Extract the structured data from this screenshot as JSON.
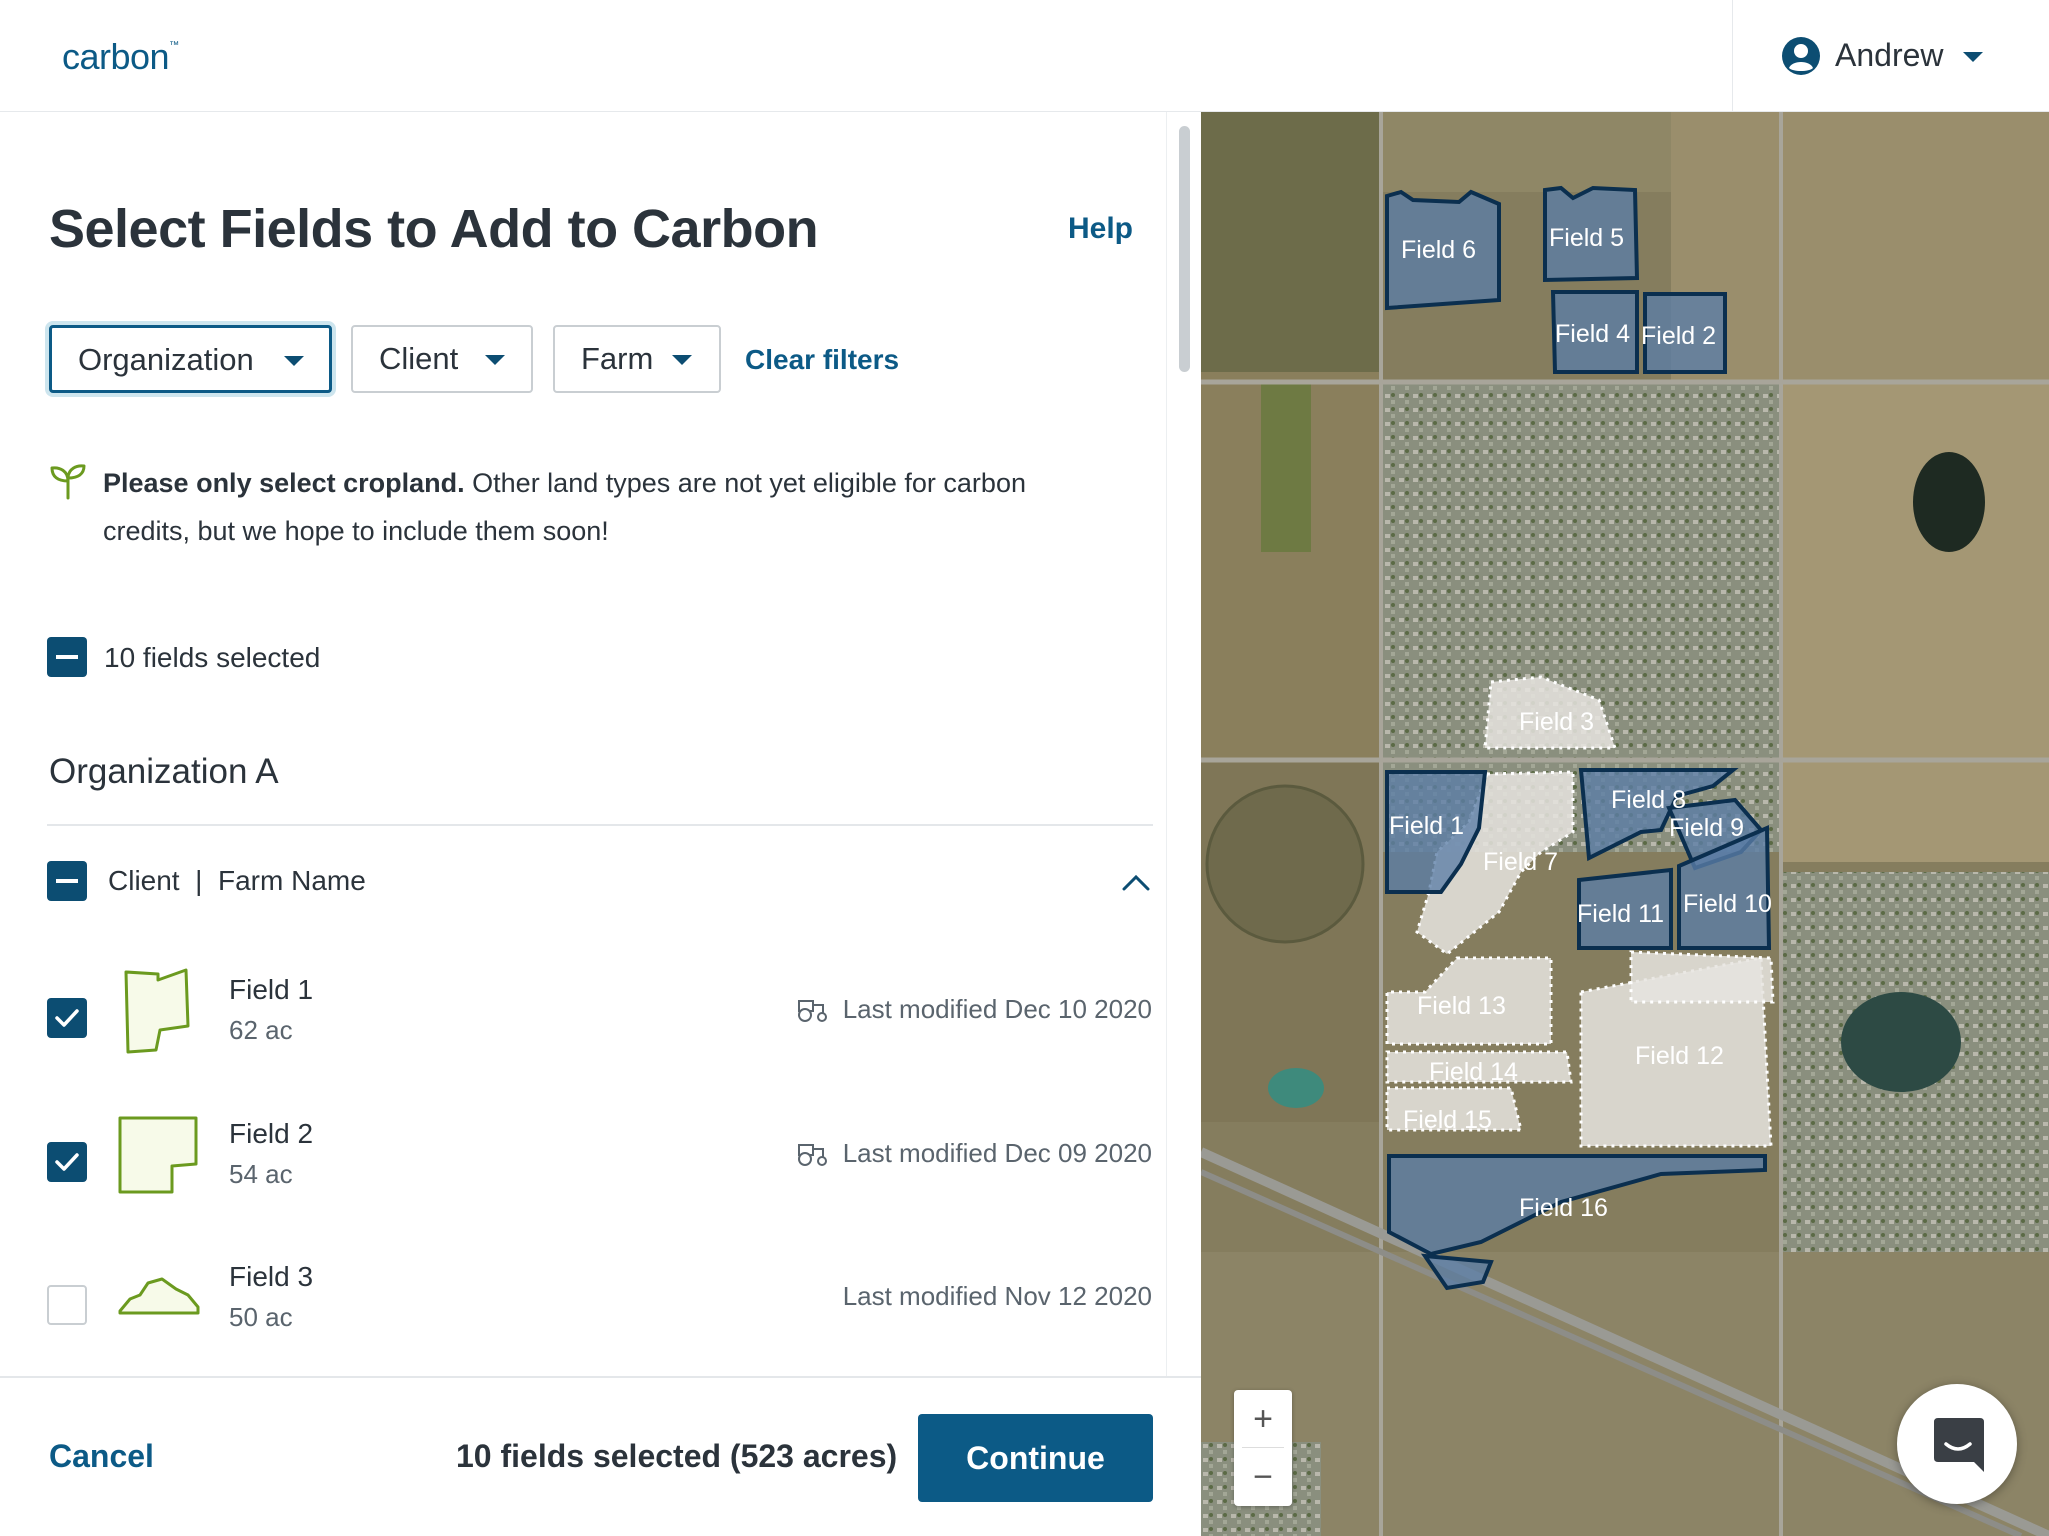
{
  "app": {
    "logo_text": "carbon"
  },
  "header": {
    "user_name": "Andrew"
  },
  "page": {
    "title": "Select Fields to Add to Carbon",
    "help_label": "Help"
  },
  "filters": {
    "organization": "Organization",
    "client": "Client",
    "farm": "Farm",
    "clear": "Clear filters"
  },
  "notice": {
    "bold": "Please only select cropland.",
    "rest": " Other land types are not yet eligible for carbon credits, but we hope to include them soon!"
  },
  "selection": {
    "count_label": "10 fields selected"
  },
  "organization": {
    "name": "Organization A",
    "group_client": "Client",
    "group_separator": "|",
    "group_farm": "Farm Name"
  },
  "fields": [
    {
      "name": "Field 1",
      "acres": "62 ac",
      "modified": "Last modified Dec 10 2020",
      "checked": true,
      "tractor": true
    },
    {
      "name": "Field 2",
      "acres": "54 ac",
      "modified": "Last modified Dec 09 2020",
      "checked": true,
      "tractor": true
    },
    {
      "name": "Field 3",
      "acres": "50 ac",
      "modified": "Last modified Nov 12 2020",
      "checked": false,
      "tractor": false
    }
  ],
  "footer": {
    "cancel": "Cancel",
    "summary": "10 fields selected (523 acres)",
    "continue": "Continue"
  },
  "map": {
    "labels": [
      "Field 1",
      "Field 2",
      "Field 3",
      "Field 4",
      "Field 5",
      "Field 6",
      "Field 7",
      "Field 8",
      "Field 9",
      "Field 10",
      "Field 11",
      "Field 12",
      "Field 13",
      "Field 14",
      "Field 15",
      "Field 16"
    ],
    "zoom_in": "+",
    "zoom_out": "−"
  },
  "colors": {
    "brand": "#0c5a86",
    "selected_fill": "#5b7ea6",
    "unselected_fill": "#e6e4df",
    "field_outline_green": "#6b9a1f"
  }
}
